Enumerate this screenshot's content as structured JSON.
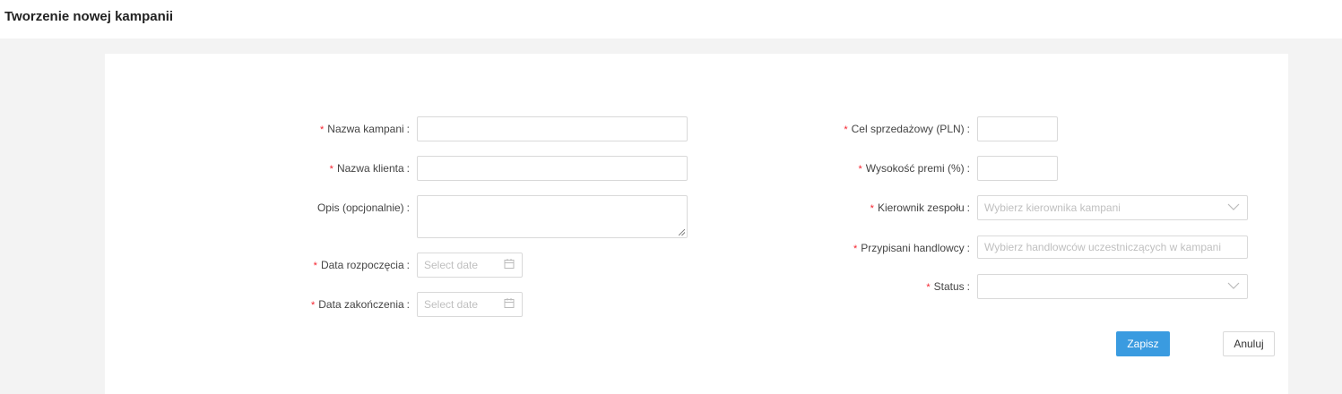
{
  "page_title": "Tworzenie nowej kampanii",
  "left_fields": [
    {
      "label": "Nazwa kampani",
      "required": true,
      "value": ""
    },
    {
      "label": "Nazwa klienta",
      "required": true,
      "value": ""
    },
    {
      "label": "Opis (opcjonalnie)",
      "required": false,
      "value": ""
    },
    {
      "label": "Data rozpoczęcia",
      "required": true,
      "placeholder": "Select date"
    },
    {
      "label": "Data zakończenia",
      "required": true,
      "placeholder": "Select date"
    }
  ],
  "right_fields": [
    {
      "label": "Cel sprzedażowy (PLN)",
      "required": true,
      "value": ""
    },
    {
      "label": "Wysokość premi (%)",
      "required": true,
      "value": ""
    },
    {
      "label": "Kierownik zespołu",
      "required": true,
      "placeholder": "Wybierz kierownika kampani"
    },
    {
      "label": "Przypisani handlowcy",
      "required": true,
      "placeholder": "Wybierz handlowców uczestniczących w kampani"
    },
    {
      "label": "Status",
      "required": true,
      "placeholder": ""
    }
  ],
  "required_mark": "*",
  "colon": ":",
  "buttons": {
    "save": "Zapisz",
    "cancel": "Anuluj"
  },
  "colors": {
    "primary": "#3a9be0",
    "required": "#f5222d"
  }
}
